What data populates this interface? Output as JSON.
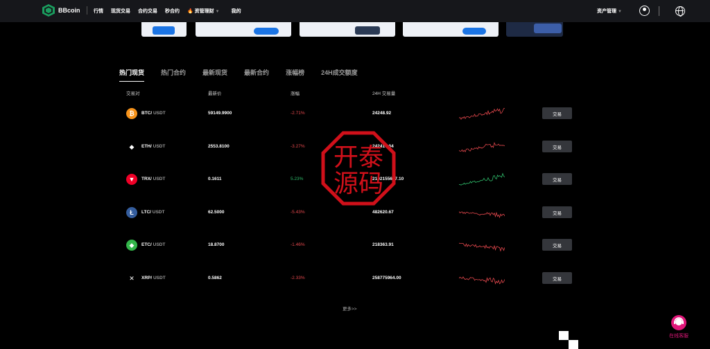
{
  "brand": {
    "name": "BBcoin"
  },
  "nav": {
    "items": [
      "行情",
      "现货交易",
      "合约交易",
      "秒合约",
      "资管理财",
      "我的"
    ]
  },
  "header_right": {
    "asset_label": "资产管理"
  },
  "tabs": [
    "热门现货",
    "热门合约",
    "最新现货",
    "最新合约",
    "涨幅榜",
    "24H成交额度"
  ],
  "table": {
    "headers": [
      "交易对",
      "最新价",
      "涨幅",
      "24H 交易量"
    ],
    "trade_label": "交易",
    "rows": [
      {
        "base": "BTC/",
        "quote": "USDT",
        "price": "59149.9900",
        "change": "-2.71%",
        "volume": "24248.92",
        "icon": "bitcoin-icon",
        "color": "#f7931a"
      },
      {
        "base": "ETH/",
        "quote": "USDT",
        "price": "2553.8100",
        "change": "-3.27%",
        "volume": "242416.04",
        "icon": "ethereum-icon",
        "color": "#ffffff"
      },
      {
        "base": "TRX/",
        "quote": "USDT",
        "price": "0.1611",
        "change": "5.23%",
        "volume": "2102155647.10",
        "icon": "tron-icon",
        "color": "#ef0027"
      },
      {
        "base": "LTC/",
        "quote": "USDT",
        "price": "62.5000",
        "change": "-5.43%",
        "volume": "482620.67",
        "icon": "litecoin-icon",
        "color": "#345d9d"
      },
      {
        "base": "ETC/",
        "quote": "USDT",
        "price": "18.8700",
        "change": "-1.46%",
        "volume": "218363.91",
        "icon": "ethereum-classic-icon",
        "color": "#33b54a"
      },
      {
        "base": "XRP/",
        "quote": "USDT",
        "price": "0.5862",
        "change": "-2.33%",
        "volume": "258775964.00",
        "icon": "xrp-icon",
        "color": "#ffffff"
      }
    ]
  },
  "more_label": "更多>>",
  "watermark": {
    "line1": "开泰",
    "line2": "源码"
  },
  "support": {
    "label": "在线客服"
  },
  "colors": {
    "up": "#2fbd6b",
    "down": "#e5484d",
    "background": "#000000",
    "topbar": "#16171b",
    "button": "#34363b",
    "accent": "#e0177a"
  }
}
